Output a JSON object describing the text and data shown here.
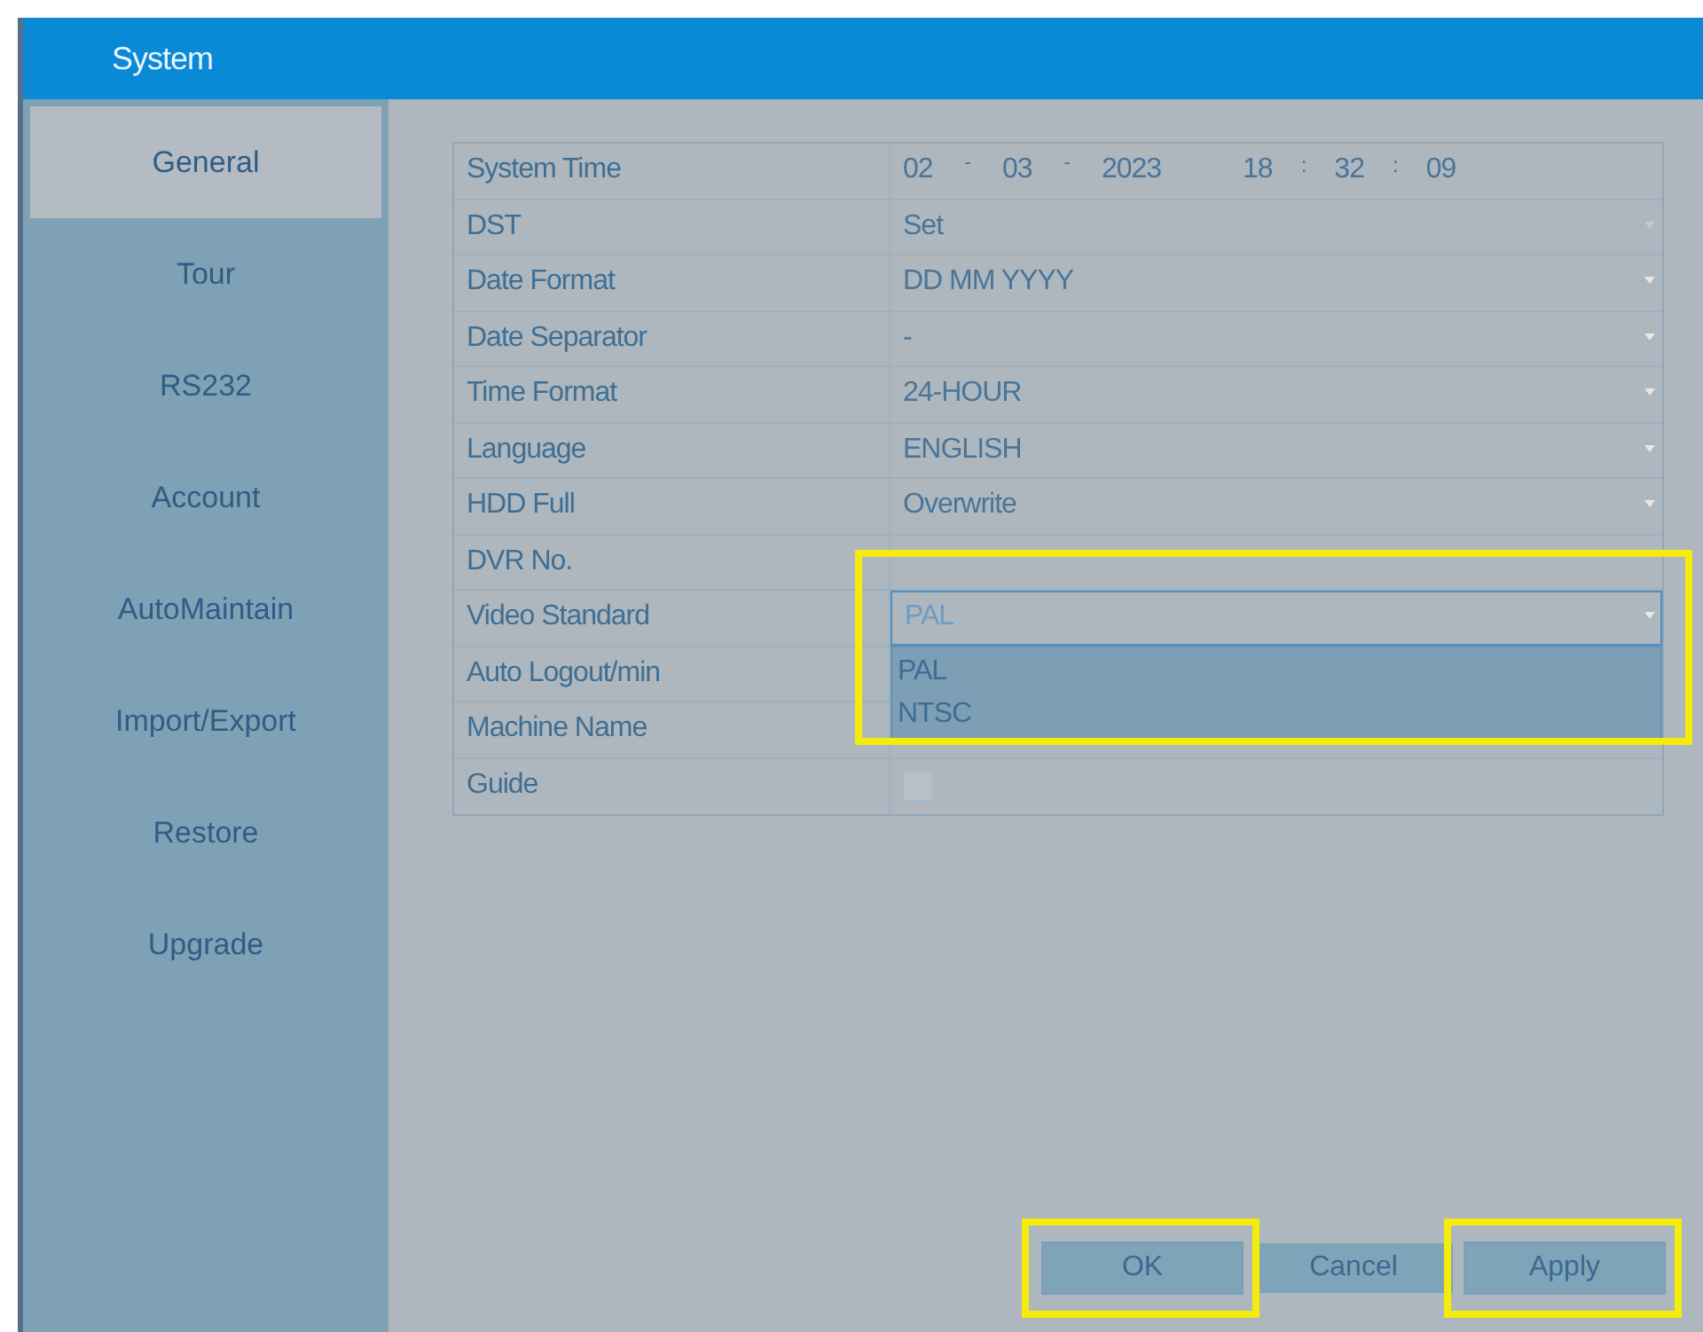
{
  "window": {
    "title": "System"
  },
  "sidebar": {
    "items": [
      {
        "label": "General",
        "selected": true
      },
      {
        "label": "Tour",
        "selected": false
      },
      {
        "label": "RS232",
        "selected": false
      },
      {
        "label": "Account",
        "selected": false
      },
      {
        "label": "AutoMaintain",
        "selected": false
      },
      {
        "label": "Import/Export",
        "selected": false
      },
      {
        "label": "Restore",
        "selected": false
      },
      {
        "label": "Upgrade",
        "selected": false
      }
    ]
  },
  "settings": [
    {
      "label": "System Time",
      "kind": "datetime",
      "date": [
        "02",
        "03",
        "2023"
      ],
      "date_separators": [
        "-",
        "-"
      ],
      "time": [
        "18",
        "32",
        "09"
      ],
      "time_separators": [
        ":",
        ":"
      ]
    },
    {
      "label": "DST",
      "kind": "button",
      "value": "Set"
    },
    {
      "label": "Date Format",
      "kind": "select",
      "value": "DD MM YYYY"
    },
    {
      "label": "Date Separator",
      "kind": "select",
      "value": "-"
    },
    {
      "label": "Time Format",
      "kind": "select",
      "value": "24-HOUR"
    },
    {
      "label": "Language",
      "kind": "select",
      "value": "ENGLISH"
    },
    {
      "label": "HDD Full",
      "kind": "select",
      "value": "Overwrite"
    },
    {
      "label": "DVR No.",
      "kind": "text"
    },
    {
      "label": "Video Standard",
      "kind": "select",
      "value": "PAL",
      "expanded": true,
      "highlighted": true,
      "options": [
        "PAL",
        "NTSC"
      ]
    },
    {
      "label": "Auto Logout/min",
      "kind": "text"
    },
    {
      "label": "Machine Name",
      "kind": "text"
    },
    {
      "label": "Guide",
      "kind": "checkbox",
      "checked": false
    }
  ],
  "buttons": [
    {
      "label": "OK",
      "highlighted": true
    },
    {
      "label": "Cancel",
      "highlighted": false
    },
    {
      "label": "Apply",
      "highlighted": true
    }
  ]
}
